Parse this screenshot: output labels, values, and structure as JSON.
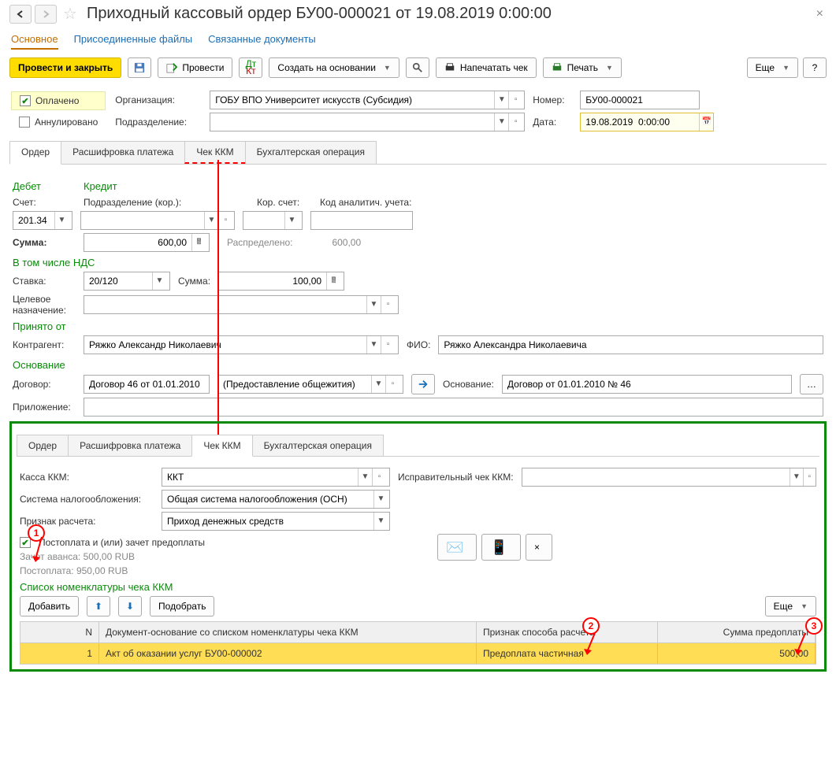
{
  "header": {
    "title": "Приходный кассовый ордер БУ00-000021 от 19.08.2019 0:00:00"
  },
  "linkTabs": {
    "main": "Основное",
    "files": "Присоединенные файлы",
    "related": "Связанные документы"
  },
  "toolbar": {
    "postClose": "Провести и закрыть",
    "post": "Провести",
    "createBased": "Создать на основании",
    "printCheck": "Напечатать чек",
    "print": "Печать",
    "more": "Еще",
    "help": "?"
  },
  "status": {
    "paid": "Оплачено",
    "voided": "Аннулировано",
    "orgLabel": "Организация:",
    "orgValue": "ГОБУ ВПО Университет искусств (Субсидия)",
    "numLabel": "Номер:",
    "numValue": "БУ00-000021",
    "deptLabel": "Подразделение:",
    "deptValue": "",
    "dateLabel": "Дата:",
    "dateValue": "19.08.2019  0:00:00"
  },
  "tabs": {
    "t1": "Ордер",
    "t2": "Расшифровка платежа",
    "t3": "Чек ККМ",
    "t4": "Бухгалтерская операция"
  },
  "order": {
    "debit": "Дебет",
    "credit": "Кредит",
    "acctLabel": "Счет:",
    "acctValue": "201.34",
    "corDeptLabel": "Подразделение (кор.):",
    "corAcctLabel": "Кор. счет:",
    "analLabel": "Код аналитич. учета:",
    "sumLabel": "Сумма:",
    "sumValue": "600,00",
    "distribLabel": "Распределено:",
    "distribValue": "600,00",
    "vatHeader": "В том числе НДС",
    "rateLabel": "Ставка:",
    "rateValue": "20/120",
    "vatSumLabel": "Сумма:",
    "vatSumValue": "100,00",
    "purposeLabel": "Целевое назначение:",
    "receivedHeader": "Принято от",
    "counterLabel": "Контрагент:",
    "counterValue": "Ряжко Александр Николаевич",
    "fioLabel": "ФИО:",
    "fioValue": "Ряжко Александра Николаевича",
    "basisHeader": "Основание",
    "contractLabel": "Договор:",
    "contractValue": "Договор 46 от 01.01.2010",
    "contractType": "(Предоставление общежития)",
    "basisLabel": "Основание:",
    "basisValue": "Договор от 01.01.2010 № 46",
    "attachLabel": "Приложение:"
  },
  "kkm": {
    "kassaLabel": "Касса ККМ:",
    "kassaValue": "ККТ",
    "corrLabel": "Исправительный чек ККМ:",
    "taxLabel": "Система налогообложения:",
    "taxValue": "Общая система налогообложения (ОСН)",
    "calcLabel": "Признак расчета:",
    "calcValue": "Приход денежных средств",
    "postpayChk": "Постоплата и (или) зачет предоплаты",
    "advanceInfo": "Зачет аванса: 500,00 RUB",
    "postpayInfo": "Постоплата: 950,00 RUB",
    "listHeader": "Список номенклатуры чека ККМ",
    "addBtn": "Добавить",
    "pickBtn": "Подобрать",
    "moreBtn": "Еще",
    "colN": "N",
    "colDoc": "Документ-основание со списком номенклатуры чека ККМ",
    "colWay": "Признак способа расчета",
    "colSum": "Сумма предоплаты",
    "rowN": "1",
    "rowDoc": "Акт об оказании услуг БУ00-000002",
    "rowWay": "Предоплата частичная",
    "rowSum": "500,00"
  },
  "callouts": {
    "c1": "1",
    "c2": "2",
    "c3": "3"
  }
}
